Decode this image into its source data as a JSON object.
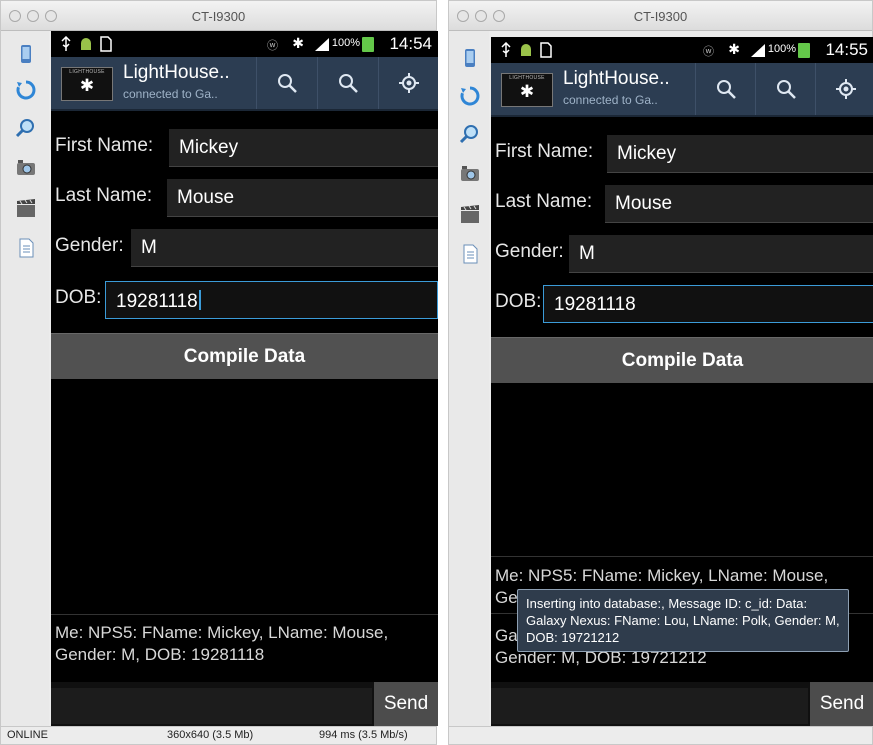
{
  "windows": [
    {
      "title": "CT-I9300",
      "status": {
        "time": "14:54",
        "battery": "100%"
      },
      "app": {
        "title": "LightHouse..",
        "subtitle": "connected to Ga..",
        "logo_text": "LIGHTHOUSE"
      },
      "form": {
        "first_name_label": "First Name:",
        "first_name_value": "Mickey",
        "last_name_label": "Last Name:",
        "last_name_value": "Mouse",
        "gender_label": "Gender:",
        "gender_value": "M",
        "dob_label": "DOB:",
        "dob_value": "19281118"
      },
      "compile_label": "Compile Data",
      "log": [
        "Me: NPS5: FName: Mickey, LName: Mouse, Gender: M, DOB: 19281118"
      ],
      "send_label": "Send",
      "footer": {
        "status": "ONLINE",
        "resolution": "360x640 (3.5 Mb)",
        "timing": "994 ms (3.5 Mb/s)"
      }
    },
    {
      "title": "CT-I9300",
      "status": {
        "time": "14:55",
        "battery": "100%"
      },
      "app": {
        "title": "LightHouse..",
        "subtitle": "connected to Ga..",
        "logo_text": "LIGHTHOUSE"
      },
      "form": {
        "first_name_label": "First Name:",
        "first_name_value": "Mickey",
        "last_name_label": "Last Name:",
        "last_name_value": "Mouse",
        "gender_label": "Gender:",
        "gender_value": "M",
        "dob_label": "DOB:",
        "dob_value": "19281118"
      },
      "compile_label": "Compile Data",
      "log": [
        "Me: NPS5: FName: Mickey, LName: Mouse,",
        "Ge",
        "Ga",
        "Gender: M, DOB: 19721212"
      ],
      "toast": "Inserting into database:, Message ID: c_id: Data: Galaxy Nexus: FName: Lou, LName: Polk, Gender: M, DOB: 19721212",
      "send_label": "Send",
      "footer": {
        "status": "",
        "resolution": "",
        "timing": ""
      }
    }
  ],
  "icons": {
    "toolstrip": [
      "device-icon",
      "rotate-icon",
      "zoom-icon",
      "camera-icon",
      "video-icon",
      "document-icon"
    ],
    "actionbar": [
      "search-icon",
      "search-icon",
      "location-icon"
    ]
  },
  "colors": {
    "actionbar": "#2c3d52",
    "input_focus": "#3b9bd8",
    "battery": "#64c84a",
    "button": "#515151"
  }
}
